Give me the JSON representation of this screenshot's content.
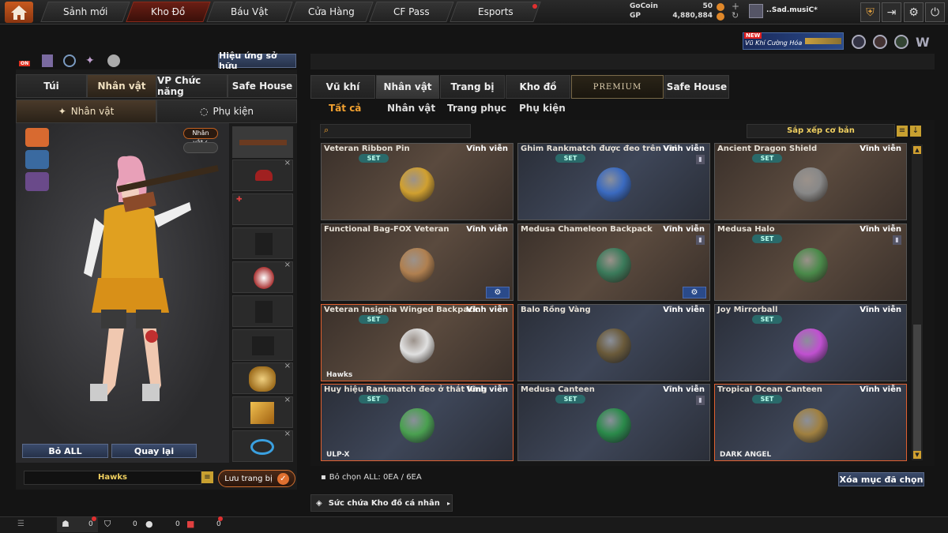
{
  "topnav": {
    "tabs": [
      "Sảnh mới",
      "Kho Đồ",
      "Báu Vật",
      "Cửa Hàng",
      "CF Pass",
      "Esports"
    ],
    "active": "Kho Đồ"
  },
  "currency": {
    "gocoin_label": "GoCoin",
    "gocoin_value": "50",
    "gp_label": "GP",
    "gp_value": "4,880,884",
    "username": "..Sad.musiC*"
  },
  "promo": {
    "new_badge": "NEW",
    "text": "Vũ Khí Cường Hóa"
  },
  "left": {
    "effect_button": "Hiệu ứng sở hữu",
    "on_badge": "ON",
    "tabs": [
      "Túi",
      "Nhân vật",
      "VP Chức năng",
      "Safe House"
    ],
    "active_tab": "Nhân vật",
    "subtabs": [
      "Nhân vật",
      "Phụ kiện"
    ],
    "char_badge": "Nhân vật",
    "deselect_all": "Bỏ ALL",
    "back": "Quay lại",
    "preset_name": "Hawks",
    "save_button": "Lưu trang bị"
  },
  "right": {
    "tabs": [
      "Vũ khí",
      "Nhân vật",
      "Trang bị",
      "Kho đồ",
      "PREMIUM",
      "Safe House"
    ],
    "active_tab": "Nhân vật",
    "subtabs": [
      "Tất cả",
      "Nhân vật",
      "Trang phục",
      "Phụ kiện"
    ],
    "active_subtab": "Tất cả",
    "search_placeholder": "",
    "sort_label": "Sắp xếp cơ bản",
    "items": [
      {
        "name": "Veteran Ribbon Pin",
        "duration": "Vĩnh viễn",
        "set": "SET",
        "style": "brown",
        "icon": "medal-icon",
        "foot": "",
        "gear": false,
        "trash": false,
        "selected": false
      },
      {
        "name": "Ghim Rankmatch được đeo trên vai",
        "duration": "Vĩnh viễn",
        "set": "SET",
        "style": "blue",
        "icon": "rank-pin-icon",
        "foot": "",
        "gear": false,
        "trash": true,
        "selected": false
      },
      {
        "name": "Ancient Dragon Shield",
        "duration": "Vĩnh viễn",
        "set": "SET",
        "style": "brown",
        "icon": "dragon-shield-icon",
        "foot": "",
        "gear": false,
        "trash": false,
        "selected": false
      },
      {
        "name": "Functional Bag-FOX Veteran",
        "duration": "Vĩnh viễn",
        "set": "",
        "style": "brown",
        "icon": "bag-icon",
        "foot": "",
        "gear": true,
        "trash": false,
        "selected": false
      },
      {
        "name": "Medusa Chameleon Backpack",
        "duration": "Vĩnh viễn",
        "set": "",
        "style": "brown",
        "icon": "backpack-icon",
        "foot": "",
        "gear": true,
        "trash": true,
        "selected": false
      },
      {
        "name": "Medusa Halo",
        "duration": "Vĩnh viễn",
        "set": "SET",
        "style": "brown",
        "icon": "halo-icon",
        "foot": "",
        "gear": false,
        "trash": true,
        "selected": false
      },
      {
        "name": "Veteran Insignia Winged Backpack",
        "duration": "Vĩnh viễn",
        "set": "SET",
        "style": "brown",
        "icon": "winged-insignia-icon",
        "foot": "Hawks",
        "gear": false,
        "trash": false,
        "selected": true
      },
      {
        "name": "Balo Rồng Vàng",
        "duration": "Vĩnh viễn",
        "set": "",
        "style": "blue",
        "icon": "dragon-backpack-icon",
        "foot": "",
        "gear": false,
        "trash": false,
        "selected": false
      },
      {
        "name": "Joy Mirrorball",
        "duration": "Vĩnh viễn",
        "set": "SET",
        "style": "blue",
        "icon": "mirrorball-icon",
        "foot": "",
        "gear": false,
        "trash": false,
        "selected": false
      },
      {
        "name": "Huy hiệu Rankmatch đeo ở thắt lưng",
        "duration": "Vĩnh viễn",
        "set": "SET",
        "style": "blue",
        "icon": "rank-badge-icon",
        "foot": "ULP-X",
        "gear": false,
        "trash": false,
        "selected": true
      },
      {
        "name": "Medusa Canteen",
        "duration": "Vĩnh viễn",
        "set": "SET",
        "style": "blue",
        "icon": "canteen-icon",
        "foot": "",
        "gear": false,
        "trash": true,
        "selected": false
      },
      {
        "name": "Tropical Ocean Canteen",
        "duration": "Vĩnh viễn",
        "set": "SET",
        "style": "blue",
        "icon": "coconut-icon",
        "foot": "DARK ANGEL",
        "gear": false,
        "trash": false,
        "selected": true
      }
    ],
    "deselect_count": "Bỏ chọn ALL: 0EA / 6EA",
    "delete_selected": "Xóa mục đã chọn",
    "capacity": "Sức chứa Kho đồ cá nhân"
  },
  "bottombar": {
    "counts": [
      "0",
      "0",
      "0",
      "0"
    ]
  }
}
